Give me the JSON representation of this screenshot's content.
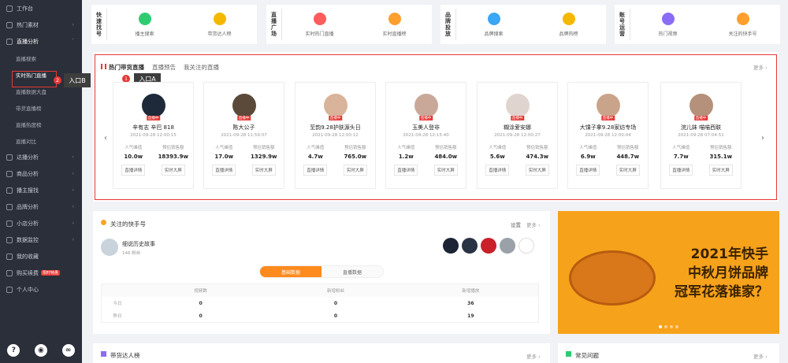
{
  "sidebar": {
    "items": [
      {
        "label": "工作台"
      },
      {
        "label": "热门素材",
        "arrow": "›"
      },
      {
        "label": "直播分析",
        "arrow": "ˇ"
      },
      {
        "label": "直播搜索",
        "sub": true
      },
      {
        "label": "实时热门直播",
        "sub": true
      },
      {
        "label": "直播数据大盘",
        "sub": true
      },
      {
        "label": "带货直播榜",
        "sub": true
      },
      {
        "label": "直播热度榜",
        "sub": true
      },
      {
        "label": "直播对比",
        "sub": true
      },
      {
        "label": "达播分析",
        "arrow": "›"
      },
      {
        "label": "商品分析",
        "arrow": "›"
      },
      {
        "label": "播主搜找",
        "arrow": "›"
      },
      {
        "label": "品牌分析",
        "arrow": "›"
      },
      {
        "label": "小店分析",
        "arrow": "›"
      },
      {
        "label": "数据监控",
        "arrow": "›"
      },
      {
        "label": "我的收藏"
      },
      {
        "label": "购买续费",
        "badge": "限时特惠"
      },
      {
        "label": "个人中心"
      }
    ]
  },
  "tooltip_b": "入口B",
  "tooltip_a": "入口A",
  "marker_b": "2",
  "marker_a": "1",
  "categories": [
    {
      "title": "快速找号",
      "items": [
        {
          "label": "播主搜索",
          "color": "#2ecc71"
        },
        {
          "label": "带货达人榜",
          "color": "#f5b800"
        }
      ]
    },
    {
      "title": "直播广场",
      "items": [
        {
          "label": "实时热门直播",
          "color": "#ff5c5c"
        },
        {
          "label": "实时直播榜",
          "color": "#ff9f2e"
        }
      ]
    },
    {
      "title": "品牌投放",
      "items": [
        {
          "label": "品牌搜索",
          "color": "#3aa7f5"
        },
        {
          "label": "品牌热榜",
          "color": "#f5b800"
        }
      ]
    },
    {
      "title": "账号运营",
      "items": [
        {
          "label": "热门视频",
          "color": "#8a6cf5"
        },
        {
          "label": "关注的快手号",
          "color": "#ff9f2e"
        }
      ]
    }
  ],
  "hot": {
    "tabs": [
      "热门带货直播",
      "直播预告",
      "我关注的直播"
    ],
    "more": "更多 ›",
    "cards": [
      {
        "name": "辛有志 辛巴 818",
        "time": "2021-09-28 12:00:15",
        "pop": "10.0w",
        "sales": "18393.9w",
        "live": "直播中",
        "avatar": "#1e2a3a"
      },
      {
        "name": "陈大公子",
        "time": "2021-09-28 11:59:07",
        "pop": "17.0w",
        "sales": "1329.9w",
        "live": "直播中",
        "avatar": "#5b4a3a"
      },
      {
        "name": "至韵9.28护肤源头日",
        "time": "2021-09-28 12:00:12",
        "pop": "4.7w",
        "sales": "765.0w",
        "live": "直播中",
        "avatar": "#d9b39a"
      },
      {
        "name": "玉美人登非",
        "time": "2021-09-28 12:15:40",
        "pop": "1.2w",
        "sales": "484.0w",
        "live": "直播中",
        "avatar": "#c9a89a"
      },
      {
        "name": "糊涂爱安娜",
        "time": "2021-09-28 12:00:27",
        "pop": "5.6w",
        "sales": "474.3w",
        "live": "直播中",
        "avatar": "#e0d4cf"
      },
      {
        "name": "大馃子拿9.28家纺专场",
        "time": "2021-09-28 12:00:04",
        "pop": "6.9w",
        "sales": "448.7w",
        "live": "直播中",
        "avatar": "#caa48a"
      },
      {
        "name": "浣儿妹 喵喵西联",
        "time": "2021-09-28 07:04:51",
        "pop": "7.7w",
        "sales": "315.1w",
        "live": "直播中",
        "avatar": "#b5907a"
      }
    ],
    "stat_pop": "人气峰值",
    "stat_sales": "预估销售额",
    "btn_detail": "直播详情",
    "btn_screen": "实时大屏"
  },
  "follow": {
    "title": "关注的快手号",
    "settings": "设置",
    "more": "更多 ›",
    "account_name": "细说历史故事",
    "followers": "146 粉丝",
    "tab_basic": "基础数据",
    "tab_live": "直播数据",
    "cols": [
      "视频数",
      "新增粉丝",
      "新增播放"
    ],
    "rows": [
      {
        "label": "今日",
        "vals": [
          "0",
          "0",
          "36"
        ]
      },
      {
        "label": "昨日",
        "vals": [
          "0",
          "0",
          "19"
        ]
      }
    ]
  },
  "banner": {
    "line1": "2021年快手",
    "line2": "中秋月饼品牌",
    "line3": "冠军花落谁家？"
  },
  "bottom": {
    "left_title": "带货达人榜",
    "left_more": "更多 ›",
    "right_title": "常见问题",
    "right_more": "更多 ›"
  }
}
